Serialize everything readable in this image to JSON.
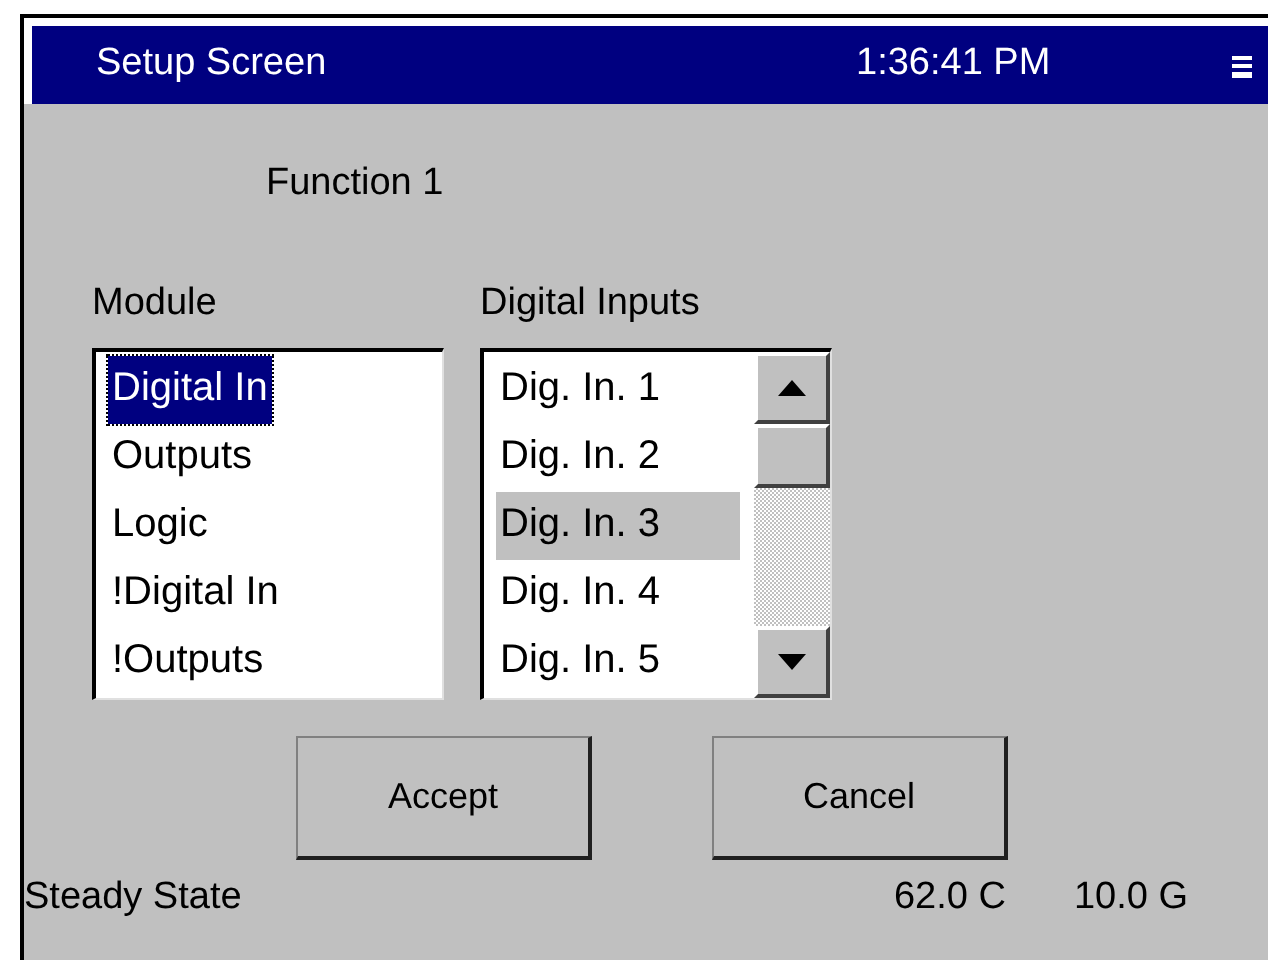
{
  "window": {
    "title": "Setup Screen",
    "time": "1:36:41 PM"
  },
  "heading": "Function 1",
  "lists": [
    {
      "label": "Module",
      "scrollbar": false,
      "items": [
        {
          "text": "Digital In",
          "selected": true
        },
        {
          "text": "Outputs",
          "selected": false
        },
        {
          "text": "Logic",
          "selected": false
        },
        {
          "text": "!Digital In",
          "selected": false
        },
        {
          "text": "!Outputs",
          "selected": false
        }
      ]
    },
    {
      "label": "Digital Inputs",
      "scrollbar": true,
      "items": [
        {
          "text": "Dig. In. 1",
          "selected": false
        },
        {
          "text": "Dig. In. 2",
          "selected": false
        },
        {
          "text": "Dig. In. 3",
          "selected": true
        },
        {
          "text": "Dig. In. 4",
          "selected": false
        },
        {
          "text": "Dig. In. 5",
          "selected": false
        }
      ]
    }
  ],
  "buttons": [
    "Accept",
    "Cancel"
  ],
  "status_bar": {
    "state": "Steady State",
    "temperature": "62.0 C",
    "force": "10.0 G"
  }
}
